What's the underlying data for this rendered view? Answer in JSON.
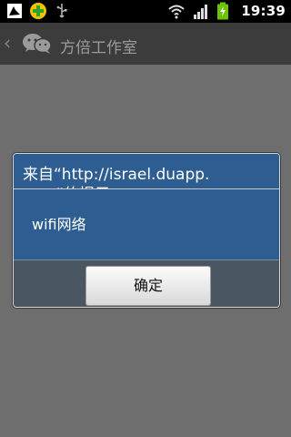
{
  "status_bar": {
    "time": "19:39",
    "icons_left": [
      "notification-icon",
      "app-icon",
      "usb-icon"
    ],
    "icons_right": [
      "wifi-icon",
      "signal-icon",
      "battery-charging-icon"
    ]
  },
  "app_bar": {
    "title": "方倍工作室",
    "back_icon": "back-chevron-icon",
    "logo_icon": "wechat-logo-icon"
  },
  "dialog": {
    "title": "来自“http://israel.duapp.\ncom”的提示：",
    "message": "wifi网络",
    "ok_label": "确定",
    "colors": {
      "header_bg": "#2e5e91",
      "button_bar_bg": "#4a5763"
    }
  }
}
